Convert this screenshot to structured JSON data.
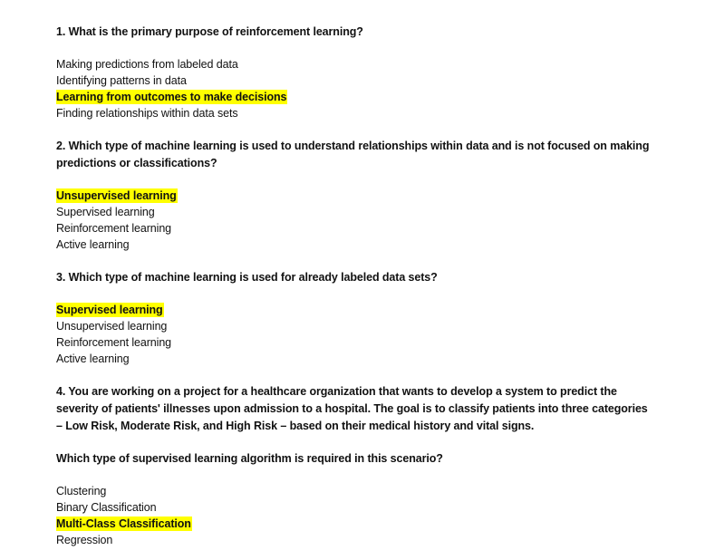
{
  "questions": [
    {
      "text": "1. What is the primary purpose of reinforcement learning?",
      "options": [
        {
          "text": "Making predictions from labeled data",
          "correct": false
        },
        {
          "text": "Identifying patterns in data",
          "correct": false
        },
        {
          "text": "Learning from outcomes to make decisions",
          "correct": true
        },
        {
          "text": "Finding relationships within data sets",
          "correct": false
        }
      ]
    },
    {
      "text": "2. Which type of machine learning is used to understand relationships within data and is not focused on making predictions or classifications?",
      "options": [
        {
          "text": "Unsupervised learning",
          "correct": true
        },
        {
          "text": "Supervised learning",
          "correct": false
        },
        {
          "text": "Reinforcement learning",
          "correct": false
        },
        {
          "text": "Active learning",
          "correct": false
        }
      ]
    },
    {
      "text": "3. Which type of machine learning is used for already labeled data sets?",
      "options": [
        {
          "text": "Supervised learning",
          "correct": true
        },
        {
          "text": "Unsupervised learning",
          "correct": false
        },
        {
          "text": "Reinforcement learning",
          "correct": false
        },
        {
          "text": "Active learning",
          "correct": false
        }
      ]
    },
    {
      "text": "4. You are working on a project for a healthcare organization that wants to develop a system to predict the severity of patients' illnesses upon admission to a hospital. The goal is to classify patients into three categories – Low Risk, Moderate Risk, and High Risk – based on their medical history and vital signs.",
      "followup": "Which type of supervised learning algorithm is required in this scenario?",
      "options": [
        {
          "text": "Clustering",
          "correct": false
        },
        {
          "text": "Binary Classification",
          "correct": false
        },
        {
          "text": "Multi-Class Classification",
          "correct": true
        },
        {
          "text": "Regression",
          "correct": false
        }
      ]
    }
  ],
  "colors": {
    "highlight": "#ffff00",
    "text": "#111111",
    "background": "#ffffff"
  }
}
